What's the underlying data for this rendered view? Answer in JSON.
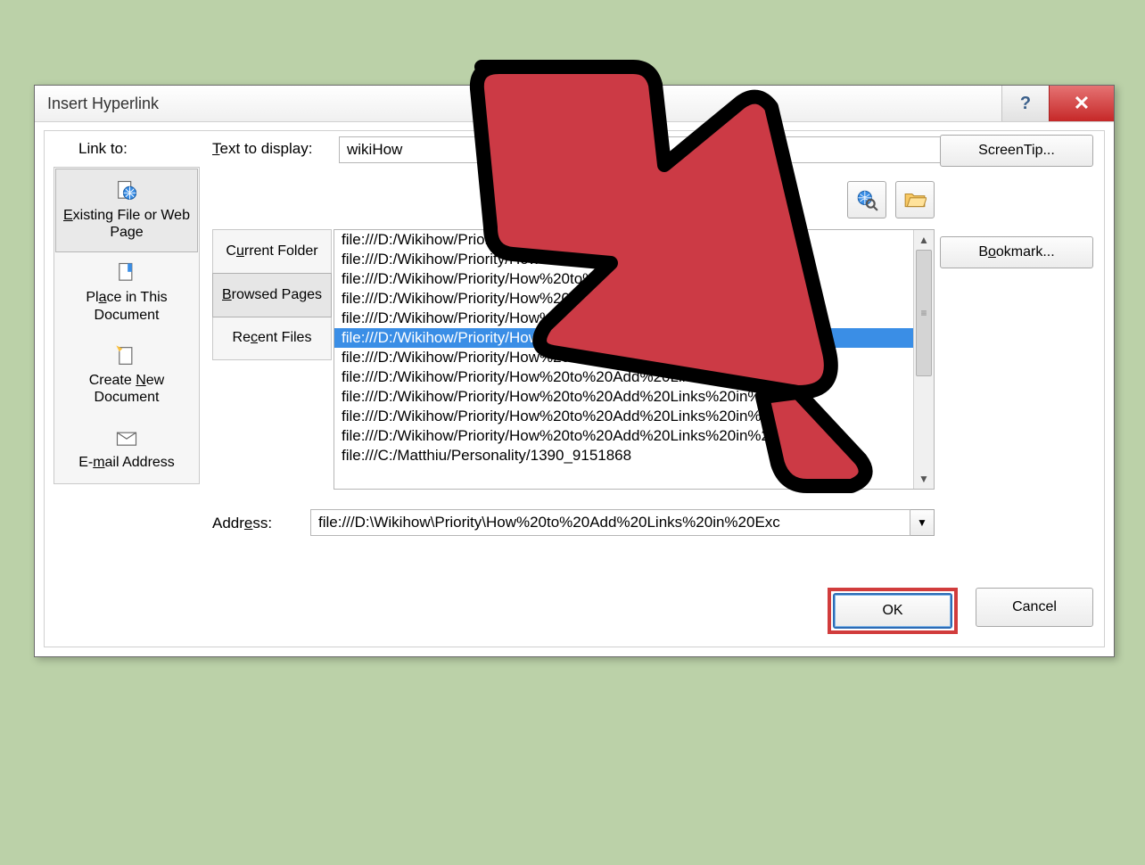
{
  "dialog": {
    "title": "Insert Hyperlink",
    "link_to_label": "Link to:",
    "text_to_display_label": "Text to display:",
    "text_to_display_value": "wikiHow",
    "screentip_label": "ScreenTip...",
    "bookmark_label": "Bookmark...",
    "address_label": "Address:",
    "address_value": "file:///D:\\Wikihow\\Priority\\How%20to%20Add%20Links%20in%20Exc",
    "ok_label": "OK",
    "cancel_label": "Cancel"
  },
  "sidebar": {
    "items": [
      {
        "label": "Existing File or Web Page",
        "selected": true
      },
      {
        "label": "Place in This Document",
        "selected": false
      },
      {
        "label": "Create New Document",
        "selected": false
      },
      {
        "label": "E-mail Address",
        "selected": false
      }
    ]
  },
  "sub_sidebar": {
    "items": [
      {
        "label": "Current Folder",
        "selected": false
      },
      {
        "label": "Browsed Pages",
        "selected": true
      },
      {
        "label": "Recent Files",
        "selected": false
      }
    ]
  },
  "file_list": {
    "selected_index": 5,
    "items": [
      "file:///D:/Wikihow/Priority/How%20to%20Add%20Links%20in%20Exc",
      "file:///D:/Wikihow/Priority/How%20to%20Add%20Links%20in%20Exc",
      "file:///D:/Wikihow/Priority/How%20to%20Add%20Links%20in%20Exc",
      "file:///D:/Wikihow/Priority/How%20to%20Add%20Links%20in%20Exc",
      "file:///D:/Wikihow/Priority/How%20to%20Add%20Links%20in%20Exc",
      "file:///D:/Wikihow/Priority/How%20to%20Add%20Links%20in%20Exc",
      "file:///D:/Wikihow/Priority/How%20to%20Add%20Links%20in%20Exc",
      "file:///D:/Wikihow/Priority/How%20to%20Add%20Links%20in%20Exc",
      "file:///D:/Wikihow/Priority/How%20to%20Add%20Links%20in%20Exc",
      "file:///D:/Wikihow/Priority/How%20to%20Add%20Links%20in%20Exc",
      "file:///D:/Wikihow/Priority/How%20to%20Add%20Links%20in%20Exc",
      "file:///C:/Matthiu/Personality/1390_9151868"
    ]
  }
}
